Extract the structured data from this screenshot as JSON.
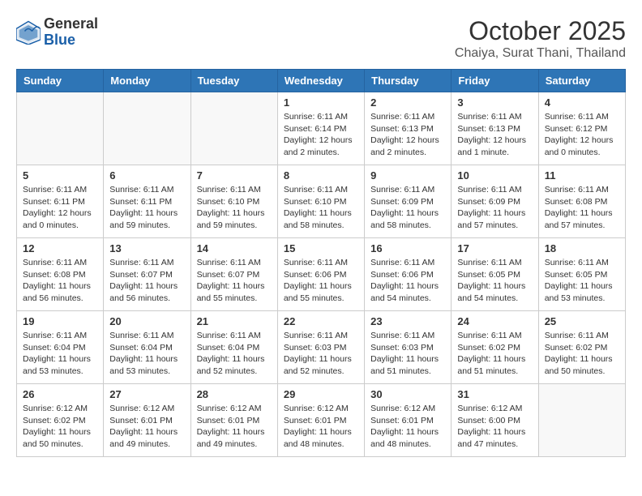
{
  "logo": {
    "general": "General",
    "blue": "Blue"
  },
  "title": "October 2025",
  "subtitle": "Chaiya, Surat Thani, Thailand",
  "weekdays": [
    "Sunday",
    "Monday",
    "Tuesday",
    "Wednesday",
    "Thursday",
    "Friday",
    "Saturday"
  ],
  "weeks": [
    [
      {
        "day": "",
        "info": ""
      },
      {
        "day": "",
        "info": ""
      },
      {
        "day": "",
        "info": ""
      },
      {
        "day": "1",
        "info": "Sunrise: 6:11 AM\nSunset: 6:14 PM\nDaylight: 12 hours\nand 2 minutes."
      },
      {
        "day": "2",
        "info": "Sunrise: 6:11 AM\nSunset: 6:13 PM\nDaylight: 12 hours\nand 2 minutes."
      },
      {
        "day": "3",
        "info": "Sunrise: 6:11 AM\nSunset: 6:13 PM\nDaylight: 12 hours\nand 1 minute."
      },
      {
        "day": "4",
        "info": "Sunrise: 6:11 AM\nSunset: 6:12 PM\nDaylight: 12 hours\nand 0 minutes."
      }
    ],
    [
      {
        "day": "5",
        "info": "Sunrise: 6:11 AM\nSunset: 6:11 PM\nDaylight: 12 hours\nand 0 minutes."
      },
      {
        "day": "6",
        "info": "Sunrise: 6:11 AM\nSunset: 6:11 PM\nDaylight: 11 hours\nand 59 minutes."
      },
      {
        "day": "7",
        "info": "Sunrise: 6:11 AM\nSunset: 6:10 PM\nDaylight: 11 hours\nand 59 minutes."
      },
      {
        "day": "8",
        "info": "Sunrise: 6:11 AM\nSunset: 6:10 PM\nDaylight: 11 hours\nand 58 minutes."
      },
      {
        "day": "9",
        "info": "Sunrise: 6:11 AM\nSunset: 6:09 PM\nDaylight: 11 hours\nand 58 minutes."
      },
      {
        "day": "10",
        "info": "Sunrise: 6:11 AM\nSunset: 6:09 PM\nDaylight: 11 hours\nand 57 minutes."
      },
      {
        "day": "11",
        "info": "Sunrise: 6:11 AM\nSunset: 6:08 PM\nDaylight: 11 hours\nand 57 minutes."
      }
    ],
    [
      {
        "day": "12",
        "info": "Sunrise: 6:11 AM\nSunset: 6:08 PM\nDaylight: 11 hours\nand 56 minutes."
      },
      {
        "day": "13",
        "info": "Sunrise: 6:11 AM\nSunset: 6:07 PM\nDaylight: 11 hours\nand 56 minutes."
      },
      {
        "day": "14",
        "info": "Sunrise: 6:11 AM\nSunset: 6:07 PM\nDaylight: 11 hours\nand 55 minutes."
      },
      {
        "day": "15",
        "info": "Sunrise: 6:11 AM\nSunset: 6:06 PM\nDaylight: 11 hours\nand 55 minutes."
      },
      {
        "day": "16",
        "info": "Sunrise: 6:11 AM\nSunset: 6:06 PM\nDaylight: 11 hours\nand 54 minutes."
      },
      {
        "day": "17",
        "info": "Sunrise: 6:11 AM\nSunset: 6:05 PM\nDaylight: 11 hours\nand 54 minutes."
      },
      {
        "day": "18",
        "info": "Sunrise: 6:11 AM\nSunset: 6:05 PM\nDaylight: 11 hours\nand 53 minutes."
      }
    ],
    [
      {
        "day": "19",
        "info": "Sunrise: 6:11 AM\nSunset: 6:04 PM\nDaylight: 11 hours\nand 53 minutes."
      },
      {
        "day": "20",
        "info": "Sunrise: 6:11 AM\nSunset: 6:04 PM\nDaylight: 11 hours\nand 53 minutes."
      },
      {
        "day": "21",
        "info": "Sunrise: 6:11 AM\nSunset: 6:04 PM\nDaylight: 11 hours\nand 52 minutes."
      },
      {
        "day": "22",
        "info": "Sunrise: 6:11 AM\nSunset: 6:03 PM\nDaylight: 11 hours\nand 52 minutes."
      },
      {
        "day": "23",
        "info": "Sunrise: 6:11 AM\nSunset: 6:03 PM\nDaylight: 11 hours\nand 51 minutes."
      },
      {
        "day": "24",
        "info": "Sunrise: 6:11 AM\nSunset: 6:02 PM\nDaylight: 11 hours\nand 51 minutes."
      },
      {
        "day": "25",
        "info": "Sunrise: 6:11 AM\nSunset: 6:02 PM\nDaylight: 11 hours\nand 50 minutes."
      }
    ],
    [
      {
        "day": "26",
        "info": "Sunrise: 6:12 AM\nSunset: 6:02 PM\nDaylight: 11 hours\nand 50 minutes."
      },
      {
        "day": "27",
        "info": "Sunrise: 6:12 AM\nSunset: 6:01 PM\nDaylight: 11 hours\nand 49 minutes."
      },
      {
        "day": "28",
        "info": "Sunrise: 6:12 AM\nSunset: 6:01 PM\nDaylight: 11 hours\nand 49 minutes."
      },
      {
        "day": "29",
        "info": "Sunrise: 6:12 AM\nSunset: 6:01 PM\nDaylight: 11 hours\nand 48 minutes."
      },
      {
        "day": "30",
        "info": "Sunrise: 6:12 AM\nSunset: 6:01 PM\nDaylight: 11 hours\nand 48 minutes."
      },
      {
        "day": "31",
        "info": "Sunrise: 6:12 AM\nSunset: 6:00 PM\nDaylight: 11 hours\nand 47 minutes."
      },
      {
        "day": "",
        "info": ""
      }
    ]
  ]
}
